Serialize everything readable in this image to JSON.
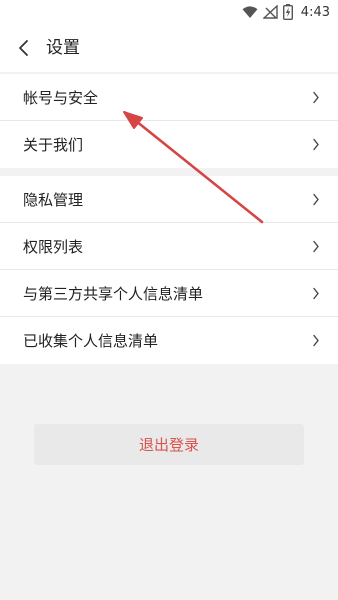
{
  "status_bar": {
    "time": "4:43",
    "icons": [
      "wifi-icon",
      "no-signal-icon",
      "battery-charging-icon"
    ]
  },
  "header": {
    "title": "设置",
    "back_icon": "chevron-left-icon"
  },
  "groups": [
    {
      "items": [
        {
          "label": "帐号与安全"
        },
        {
          "label": "关于我们"
        }
      ]
    },
    {
      "items": [
        {
          "label": "隐私管理"
        },
        {
          "label": "权限列表"
        },
        {
          "label": "与第三方共享个人信息清单"
        },
        {
          "label": "已收集个人信息清单"
        }
      ]
    }
  ],
  "logout": {
    "label": "退出登录",
    "color": "#d9534f"
  },
  "annotation": {
    "color": "#d64545",
    "icon": "arrow-annotation"
  }
}
